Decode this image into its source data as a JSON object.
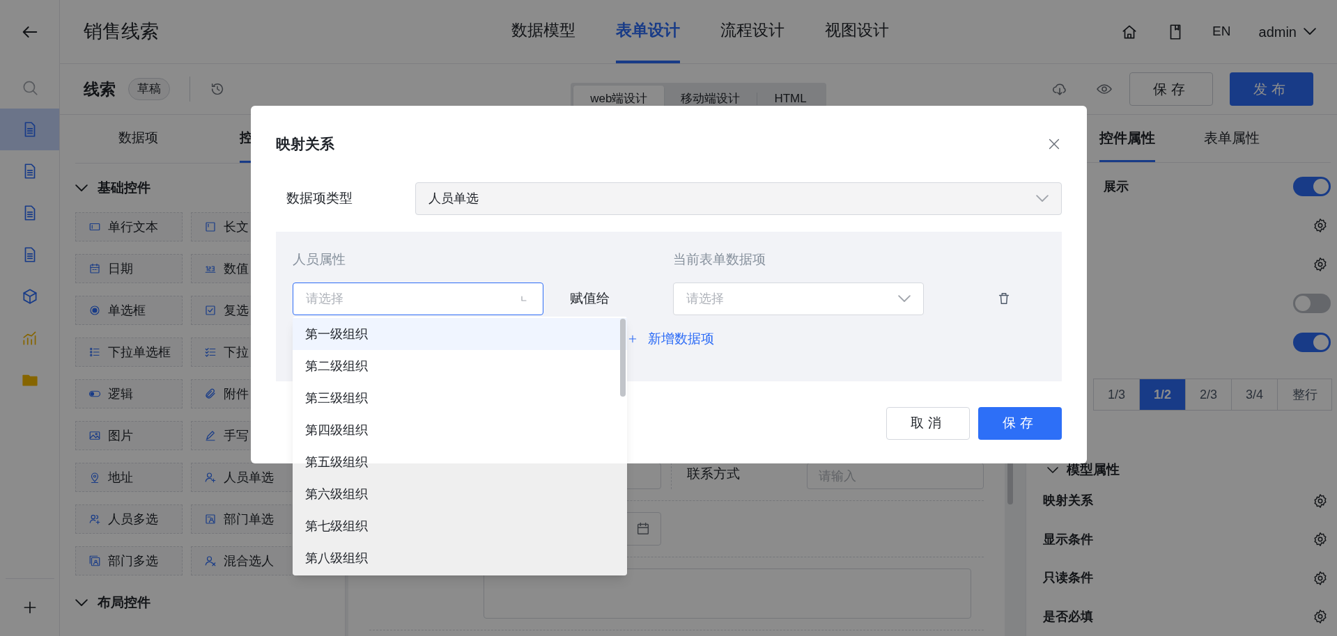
{
  "app_header": {
    "title": "销售线索",
    "nav": [
      {
        "label": "数据模型",
        "selected": false
      },
      {
        "label": "表单设计",
        "selected": true
      },
      {
        "label": "流程设计",
        "selected": false
      },
      {
        "label": "视图设计",
        "selected": false
      }
    ],
    "language": "EN",
    "user": "admin"
  },
  "rail": {
    "items": [
      {
        "kind": "search",
        "selected": false
      },
      {
        "kind": "document",
        "selected": true
      },
      {
        "kind": "document",
        "selected": false
      },
      {
        "kind": "document",
        "selected": false
      },
      {
        "kind": "document",
        "selected": false
      },
      {
        "kind": "cube",
        "selected": false
      },
      {
        "kind": "chart",
        "selected": false
      },
      {
        "kind": "folder",
        "selected": false
      }
    ]
  },
  "toolbar": {
    "form_name": "线索",
    "status_badge": "草稿",
    "design_modes": [
      {
        "label": "web端设计",
        "selected": true
      },
      {
        "label": "移动端设计",
        "selected": false
      },
      {
        "label": "HTML",
        "selected": false
      }
    ],
    "buttons": [
      {
        "label": "保存",
        "kind": "secondary"
      },
      {
        "label": "发布",
        "kind": "primary"
      }
    ]
  },
  "left_panel": {
    "tabs": [
      {
        "label": "数据项",
        "selected": false
      },
      {
        "label": "控",
        "selected": true
      }
    ],
    "groups": [
      {
        "title": "基础控件",
        "expanded": true,
        "items": [
          {
            "label": "单行文本",
            "kind": "text"
          },
          {
            "label": "长文",
            "kind": "textarea"
          },
          {
            "label": "日期",
            "kind": "date"
          },
          {
            "label": "数值",
            "kind": "number"
          },
          {
            "label": "单选框",
            "kind": "radio"
          },
          {
            "label": "复选",
            "kind": "checkbox"
          },
          {
            "label": "下拉单选框",
            "kind": "select"
          },
          {
            "label": "下拉",
            "kind": "multiselect"
          },
          {
            "label": "逻辑",
            "kind": "logic"
          },
          {
            "label": "附件",
            "kind": "attachment"
          },
          {
            "label": "图片",
            "kind": "image"
          },
          {
            "label": "手写",
            "kind": "signature"
          },
          {
            "label": "地址",
            "kind": "address"
          },
          {
            "label": "人员单选",
            "kind": "user"
          },
          {
            "label": "人员多选",
            "kind": "users"
          },
          {
            "label": "部门单选",
            "kind": "dept"
          },
          {
            "label": "部门多选",
            "kind": "depts"
          },
          {
            "label": "混合选人",
            "kind": "mixed"
          }
        ]
      },
      {
        "title": "布局控件",
        "expanded": true
      }
    ]
  },
  "form_canvas": {
    "rows": [
      {
        "kind": "split",
        "right_label": "联系方式",
        "right_placeholder": "请输入"
      },
      {
        "kind": "date"
      },
      {
        "kind": "textarea"
      }
    ]
  },
  "right_panel": {
    "tabs": [
      {
        "label": "控件属性",
        "selected": true
      },
      {
        "label": "表单属性",
        "selected": false
      }
    ],
    "settings": [
      {
        "kind": "toggle",
        "label": "展示",
        "on": true
      },
      {
        "kind": "gear"
      },
      {
        "kind": "gear"
      },
      {
        "kind": "toggle",
        "on": false
      },
      {
        "kind": "toggle",
        "on": true
      }
    ],
    "width_options": [
      {
        "label": "1/3",
        "selected": false
      },
      {
        "label": "1/2",
        "selected": true
      },
      {
        "label": "2/3",
        "selected": false
      },
      {
        "label": "3/4",
        "selected": false
      },
      {
        "label": "整行",
        "selected": false
      }
    ],
    "model_section": {
      "title": "模型属性",
      "rows": [
        {
          "label": "映射关系"
        },
        {
          "label": "显示条件"
        },
        {
          "label": "只读条件"
        },
        {
          "label": "是否必填"
        }
      ]
    }
  },
  "dialog": {
    "title": "映射关系",
    "type_field": {
      "label": "数据项类型",
      "value": "人员单选"
    },
    "mapping": {
      "source_header": "人员属性",
      "target_header": "当前表单数据项",
      "rows": [
        {
          "source": {
            "placeholder": "请选择",
            "focused": true
          },
          "connector": "赋值给",
          "target": {
            "placeholder": "请选择",
            "focused": false
          }
        }
      ],
      "add_link": "新增数据项"
    },
    "buttons": [
      {
        "label": "取消",
        "kind": "secondary"
      },
      {
        "label": "保存",
        "kind": "primary"
      }
    ],
    "dropdown": {
      "options": [
        {
          "label": "第一级组织",
          "highlighted": true
        },
        {
          "label": "第二级组织",
          "highlighted": false
        },
        {
          "label": "第三级组织",
          "highlighted": false
        },
        {
          "label": "第四级组织",
          "highlighted": false
        },
        {
          "label": "第五级组织",
          "highlighted": false
        },
        {
          "label": "第六级组织",
          "highlighted": false
        },
        {
          "label": "第七级组织",
          "highlighted": false
        },
        {
          "label": "第八级组织",
          "highlighted": false
        }
      ]
    }
  }
}
